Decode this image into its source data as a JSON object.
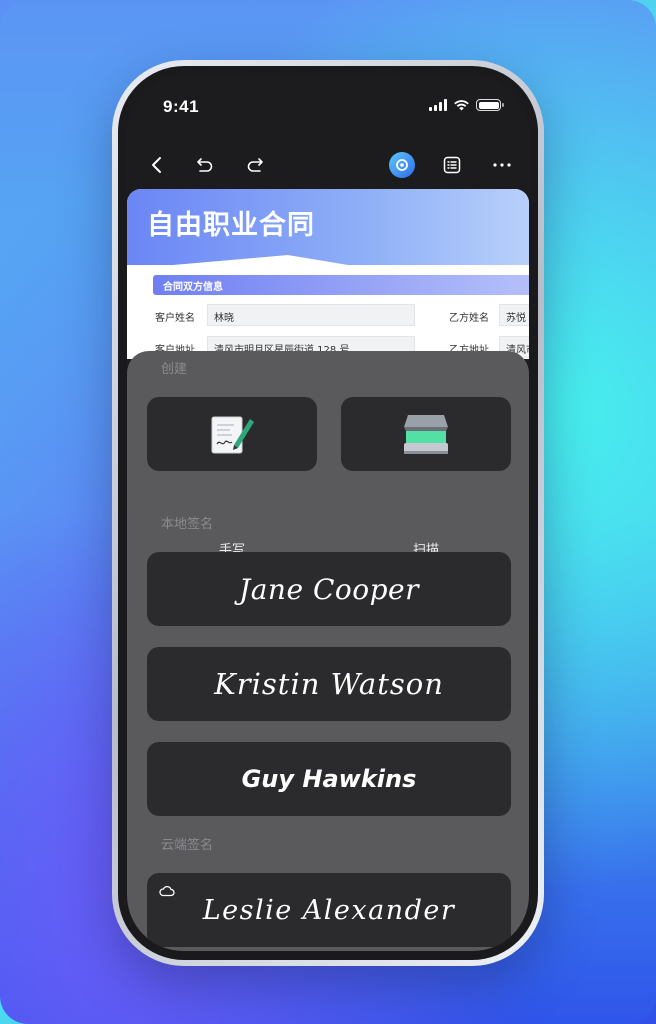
{
  "status": {
    "time": "9:41"
  },
  "document": {
    "title": "自由职业合同",
    "section_title": "合同双方信息",
    "fields": [
      {
        "label": "客户姓名",
        "value": "林晓"
      },
      {
        "label": "乙方姓名",
        "value": "苏悦"
      },
      {
        "label": "客户地址",
        "value": "清风市明月区星辰街道 128 号"
      },
      {
        "label": "乙方地址",
        "value": "清风市"
      }
    ]
  },
  "sheet": {
    "create_label": "创建",
    "create_options": [
      {
        "label": "手写",
        "icon": "handwriting-icon"
      },
      {
        "label": "扫描",
        "icon": "scanner-icon"
      }
    ],
    "local_label": "本地签名",
    "local_signatures": [
      "Jane Cooper",
      "Kristin Watson",
      "Guy Hawkins"
    ],
    "cloud_label": "云端签名",
    "cloud_signatures": [
      "Leslie Alexander"
    ]
  },
  "colors": {
    "sheet_bg": "#5a5a5d",
    "card_bg": "#2b2b2d",
    "header_gradient_start": "#6b86f5"
  }
}
